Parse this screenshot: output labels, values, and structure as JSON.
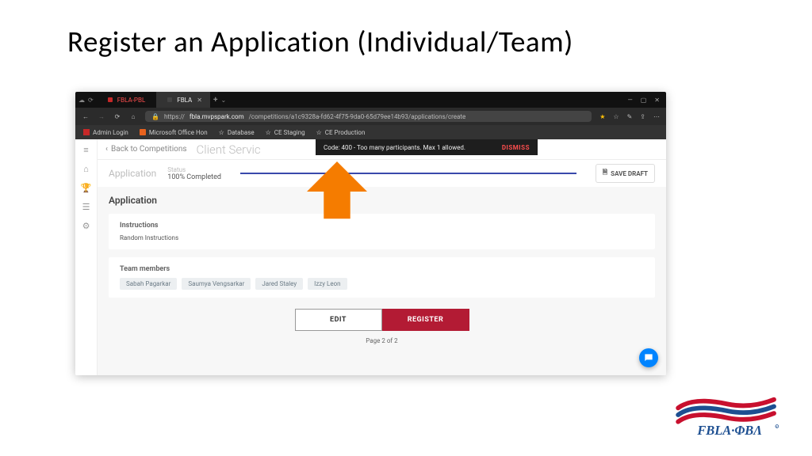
{
  "slide": {
    "title": "Register an Application (Individual/Team)"
  },
  "titlebar": {
    "tabs": [
      {
        "label": "FBLA-PBL",
        "active": false
      },
      {
        "label": "FBLA",
        "active": true
      }
    ],
    "windowButtons": [
      "min",
      "max",
      "close"
    ]
  },
  "addressbar": {
    "url_prefix": "https://",
    "url_host": "fbla.mvpspark.com",
    "url_path": "/competitions/a1c9328a-fd62-4f75-9da0-65d79ee14b93/applications/create"
  },
  "bookmarks": [
    {
      "label": "Admin Login",
      "icon": "red"
    },
    {
      "label": "Microsoft Office Hon",
      "icon": "orange"
    },
    {
      "label": "Database",
      "icon": "star"
    },
    {
      "label": "CE Staging",
      "icon": "star"
    },
    {
      "label": "CE Production",
      "icon": "star"
    }
  ],
  "sidebar": {
    "items": [
      "menu",
      "home",
      "trophy",
      "list",
      "settings"
    ]
  },
  "topbar": {
    "back_label": "Back to Competitions",
    "title": "Client Servic"
  },
  "toast": {
    "message": "Code: 400 - Too many participants. Max 1 allowed.",
    "dismiss_label": "DISMISS"
  },
  "status": {
    "label": "Application",
    "small_label": "Status",
    "value": "100% Completed",
    "save_label": "SAVE DRAFT"
  },
  "panel": {
    "title": "Application",
    "instructions_head": "Instructions",
    "instructions_body": "Random Instructions",
    "team_head": "Team members",
    "team_members": [
      "Sabah Pagarkar",
      "Saumya Vengsarkar",
      "Jared Staley",
      "Izzy Leon"
    ]
  },
  "actions": {
    "edit_label": "EDIT",
    "register_label": "REGISTER"
  },
  "pager": {
    "text": "Page 2 of 2"
  },
  "logo": {
    "text": "FBLA·ΦBΛ"
  }
}
